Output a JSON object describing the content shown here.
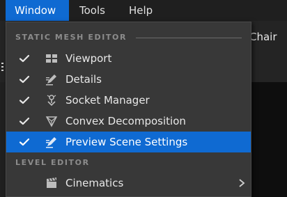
{
  "menubar": {
    "items": [
      {
        "label": "Window"
      },
      {
        "label": "Tools"
      },
      {
        "label": "Help"
      }
    ]
  },
  "background": {
    "asset_title": "Chair"
  },
  "window_menu": {
    "sections": [
      {
        "header": "STATIC MESH EDITOR",
        "items": [
          {
            "label": "Viewport",
            "checked": true,
            "icon": "viewport-icon"
          },
          {
            "label": "Details",
            "checked": true,
            "icon": "details-icon"
          },
          {
            "label": "Socket Manager",
            "checked": true,
            "icon": "socket-icon"
          },
          {
            "label": "Convex Decomposition",
            "checked": true,
            "icon": "convex-icon"
          },
          {
            "label": "Preview Scene Settings",
            "checked": true,
            "icon": "preview-settings-icon",
            "highlighted": true
          }
        ]
      },
      {
        "header": "LEVEL EDITOR",
        "items": [
          {
            "label": "Cinematics",
            "checked": false,
            "icon": "clapperboard-icon",
            "has_submenu": true
          }
        ]
      }
    ]
  },
  "colors": {
    "accent": "#0f6ad2",
    "menu_bg": "#383838",
    "section_text": "#8c8c8c"
  }
}
